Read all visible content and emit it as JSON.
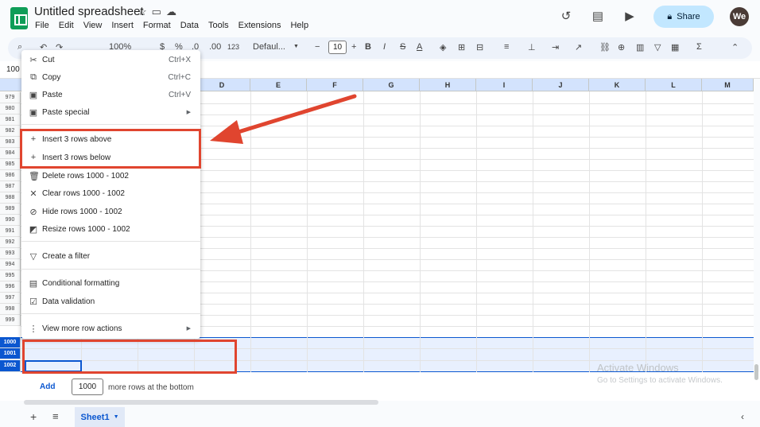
{
  "title": "Untitled spreadsheet",
  "menus": [
    "File",
    "Edit",
    "View",
    "Insert",
    "Format",
    "Data",
    "Tools",
    "Extensions",
    "Help"
  ],
  "top_right": {
    "share_label": "Share",
    "avatar_initials": "We"
  },
  "toolbar": {
    "zoom": "100%",
    "currency": "$",
    "percent": "%",
    "decrease_decimal": ".0",
    "increase_decimal": ".00",
    "number_format": "123",
    "font": "Defaul...",
    "font_size": "10",
    "bold": "B",
    "italic": "I",
    "strike": "S",
    "text_color": "A",
    "sum": "Σ"
  },
  "namebox": "100",
  "columns": [
    "D",
    "E",
    "F",
    "G",
    "H",
    "I",
    "J",
    "K",
    "L",
    "M"
  ],
  "rows": [
    "979",
    "980",
    "981",
    "982",
    "983",
    "984",
    "985",
    "986",
    "987",
    "988",
    "989",
    "990",
    "991",
    "992",
    "993",
    "994",
    "995",
    "996",
    "997",
    "998",
    "999",
    "1000",
    "1001",
    "1002"
  ],
  "context_menu": {
    "cut": {
      "label": "Cut",
      "shortcut": "Ctrl+X"
    },
    "copy": {
      "label": "Copy",
      "shortcut": "Ctrl+C"
    },
    "paste": {
      "label": "Paste",
      "shortcut": "Ctrl+V"
    },
    "paste_special": {
      "label": "Paste special"
    },
    "insert_above": {
      "label": "Insert 3 rows above"
    },
    "insert_below": {
      "label": "Insert 3 rows below"
    },
    "delete_rows": {
      "label": "Delete rows 1000 - 1002"
    },
    "clear_rows": {
      "label": "Clear rows 1000 - 1002"
    },
    "hide_rows": {
      "label": "Hide rows 1000 - 1002"
    },
    "resize_rows": {
      "label": "Resize rows 1000 - 1002"
    },
    "create_filter": {
      "label": "Create a filter"
    },
    "conditional_formatting": {
      "label": "Conditional formatting"
    },
    "data_validation": {
      "label": "Data validation"
    },
    "more_row_actions": {
      "label": "View more row actions"
    }
  },
  "add_rows": {
    "button": "Add",
    "count": "1000",
    "suffix": "more rows at the bottom"
  },
  "watermark": {
    "line1": "Activate Windows",
    "line2": "Go to Settings to activate Windows."
  },
  "sheet_tab": "Sheet1",
  "colors": {
    "accent": "#0b57d0",
    "annotation": "#e0452f",
    "share": "#c2e7ff"
  }
}
